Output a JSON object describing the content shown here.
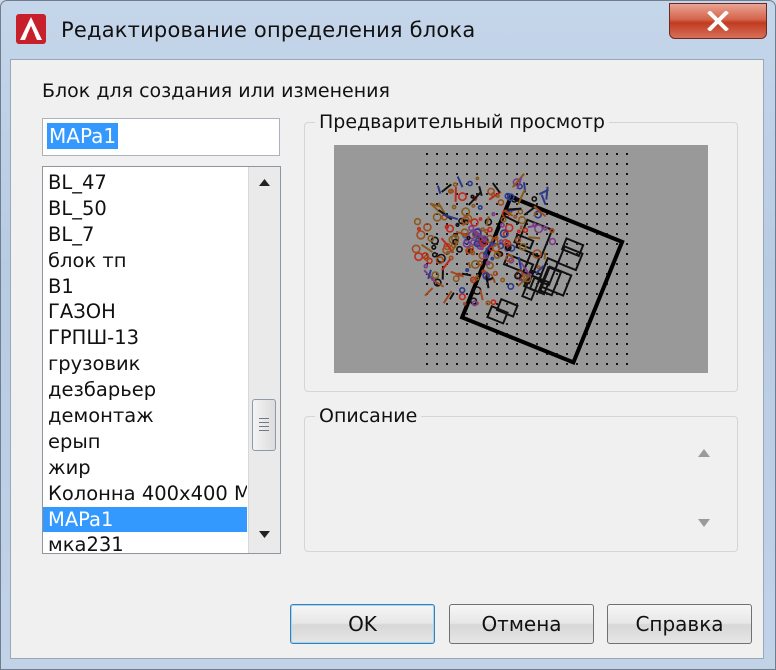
{
  "window": {
    "title": "Редактирование определения блока"
  },
  "block_selector": {
    "label": "Блок для создания или изменения",
    "name_value": "MAPa1",
    "items": [
      {
        "label": "BL_47",
        "selected": false
      },
      {
        "label": "BL_50",
        "selected": false
      },
      {
        "label": "BL_7",
        "selected": false
      },
      {
        "label": "блок тп",
        "selected": false
      },
      {
        "label": "В1",
        "selected": false
      },
      {
        "label": "ГАЗОН",
        "selected": false
      },
      {
        "label": "ГРПШ-13",
        "selected": false
      },
      {
        "label": "грузовик",
        "selected": false
      },
      {
        "label": "дезбарьер",
        "selected": false
      },
      {
        "label": "демонтаж",
        "selected": false
      },
      {
        "label": "ерып",
        "selected": false
      },
      {
        "label": "жир",
        "selected": false
      },
      {
        "label": "Колонна 400х400 М",
        "selected": false
      },
      {
        "label": "MAPa1",
        "selected": true
      },
      {
        "label": "мка231",
        "selected": false
      }
    ]
  },
  "preview": {
    "title": "Предварительный просмотр"
  },
  "description": {
    "title": "Описание",
    "value": ""
  },
  "buttons": {
    "ok": "OK",
    "cancel": "Отмена",
    "help": "Справка"
  },
  "colors": {
    "selection": "#3399ff",
    "preview_background": "#999999",
    "close_button": "#c13b20"
  }
}
